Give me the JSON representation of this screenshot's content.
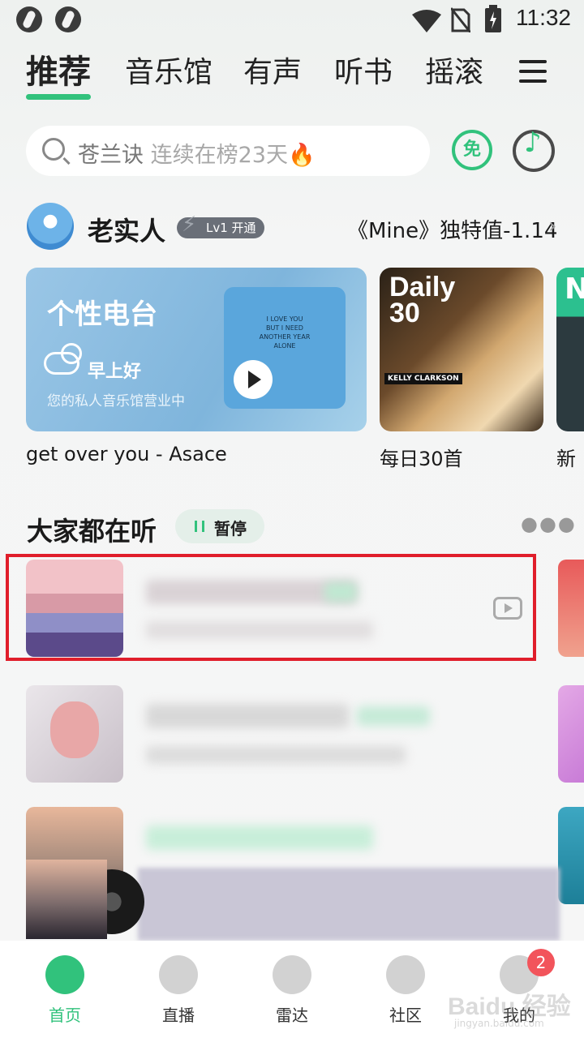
{
  "status_bar": {
    "time": "11:32"
  },
  "tabs": [
    {
      "label": "推荐",
      "active": true
    },
    {
      "label": "音乐馆"
    },
    {
      "label": "有声"
    },
    {
      "label": "听书"
    },
    {
      "label": "摇滚"
    }
  ],
  "search": {
    "query": "苍兰诀",
    "hint": "连续在榜23天"
  },
  "free_badge": "免",
  "user": {
    "name": "老实人",
    "vip_badge": "Lv1 开通",
    "mine_label": "《Mine》独特值-1.14"
  },
  "radio_card": {
    "title": "个性电台",
    "greeting": "早上好",
    "subtitle": "您的私人音乐馆营业中",
    "cover_lyrics": "I LOVE YOU\nBUT I NEED\nANOTHER YEAR\nALONE",
    "caption": "get over you - Asace"
  },
  "daily_card": {
    "title": "Daily\n30",
    "artist": "KELLY CLARKSON",
    "caption": "每日30首"
  },
  "new_card": {
    "letter": "N",
    "caption": "新"
  },
  "section": {
    "title": "大家都在听",
    "pause_label": "暂停"
  },
  "mini_player": {},
  "bottom_nav": [
    {
      "label": "首页",
      "active": true
    },
    {
      "label": "直播"
    },
    {
      "label": "雷达"
    },
    {
      "label": "社区"
    },
    {
      "label": "我的"
    }
  ],
  "notification_count": "2",
  "watermark": "Baidu 经验",
  "watermark_sub": "jingyan.baidu.com",
  "colors": {
    "accent": "#31c27c",
    "highlight": "#e01e2b",
    "badge": "#f2545b"
  }
}
